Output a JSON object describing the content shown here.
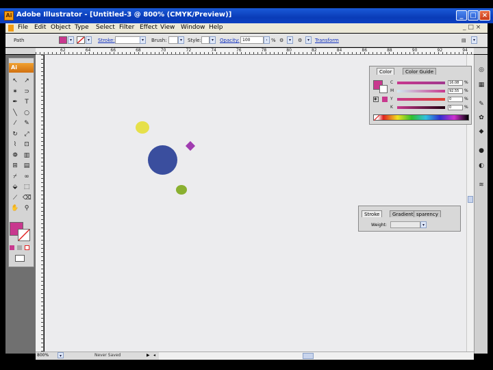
{
  "window": {
    "title": "Adobe Illustrator - [Untitled-3 @ 800% (CMYK/Preview)]",
    "buttons": {
      "minimize": "_",
      "maximize": "□",
      "close": "×"
    }
  },
  "menubar": {
    "items": [
      "File",
      "Edit",
      "Object",
      "Type",
      "Select",
      "Filter",
      "Effect",
      "View",
      "Window",
      "Help"
    ],
    "doc_controls": "_ □ ×"
  },
  "controlbar": {
    "selection_label": "Path",
    "fill_color": "#c8388e",
    "stroke_label": "Stroke:",
    "brush_label": "Brush:",
    "style_label": "Style:",
    "opacity_label": "Opacity:",
    "opacity_value": "100",
    "opacity_unit": "%",
    "transform_label": "Transform"
  },
  "toolbox": {
    "logo": "Ai",
    "fill_color": "#c8388e",
    "stroke": "none"
  },
  "ruler": {
    "ticks": [
      "62",
      "64",
      "66",
      "68",
      "70",
      "72",
      "74",
      "76",
      "78",
      "80",
      "82",
      "84",
      "86",
      "88",
      "90",
      "92",
      "94"
    ]
  },
  "color_panel": {
    "tabs": [
      "Color",
      "Color Guide"
    ],
    "fill_color": "#c8388e",
    "channels": [
      {
        "label": "C",
        "value": "16.08",
        "unit": "%"
      },
      {
        "label": "M",
        "value": "92.55",
        "unit": "%"
      },
      {
        "label": "Y",
        "value": "0",
        "unit": "%"
      },
      {
        "label": "K",
        "value": "0",
        "unit": "%"
      }
    ]
  },
  "stroke_panel": {
    "tabs": [
      "Stroke",
      "Gradient",
      "sparency"
    ],
    "weight_label": "Weight:"
  },
  "statusbar": {
    "zoom": "800%",
    "status": "Never Saved"
  },
  "canvas": {
    "background": "#ececee",
    "shapes": [
      {
        "name": "yellow-dot",
        "color": "#e6e04a"
      },
      {
        "name": "blue-circle",
        "color": "#3a4e9e"
      },
      {
        "name": "purple-diamond",
        "color": "#a03cb0"
      },
      {
        "name": "green-dot",
        "color": "#8ab030"
      }
    ]
  }
}
